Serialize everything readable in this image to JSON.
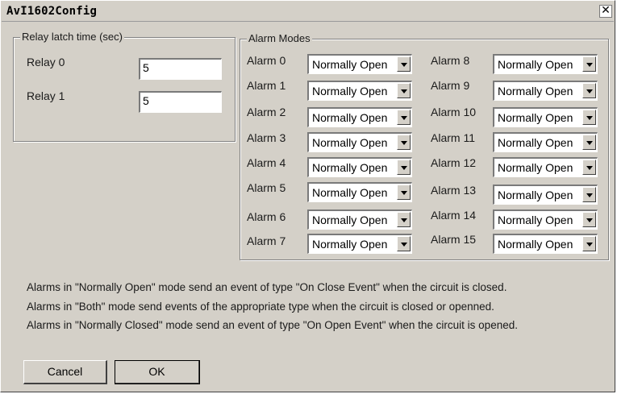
{
  "window": {
    "title": "AvI1602Config",
    "close_glyph": "✕"
  },
  "relay_group": {
    "legend": "Relay latch time (sec)",
    "relays": [
      {
        "label": "Relay 0",
        "value": "5"
      },
      {
        "label": "Relay 1",
        "value": "5"
      }
    ]
  },
  "alarm_group": {
    "legend": "Alarm Modes",
    "alarms": [
      {
        "label": "Alarm 0",
        "mode": "Normally Open"
      },
      {
        "label": "Alarm 1",
        "mode": "Normally Open"
      },
      {
        "label": "Alarm 2",
        "mode": "Normally Open"
      },
      {
        "label": "Alarm 3",
        "mode": "Normally Open"
      },
      {
        "label": "Alarm 4",
        "mode": "Normally Open"
      },
      {
        "label": "Alarm 5",
        "mode": "Normally Open"
      },
      {
        "label": "Alarm 6",
        "mode": "Normally Open"
      },
      {
        "label": "Alarm 7",
        "mode": "Normally Open"
      },
      {
        "label": "Alarm 8",
        "mode": "Normally Open"
      },
      {
        "label": "Alarm 9",
        "mode": "Normally Open"
      },
      {
        "label": "Alarm 10",
        "mode": "Normally Open"
      },
      {
        "label": "Alarm 11",
        "mode": "Normally Open"
      },
      {
        "label": "Alarm 12",
        "mode": "Normally Open"
      },
      {
        "label": "Alarm 13",
        "mode": "Normally Open"
      },
      {
        "label": "Alarm 14",
        "mode": "Normally Open"
      },
      {
        "label": "Alarm 15",
        "mode": "Normally Open"
      }
    ]
  },
  "info_lines": [
    "Alarms in \"Normally Open\" mode send an event of type \"On Close Event\" when the circuit is closed.",
    "Alarms in \"Both\" mode send events of the appropriate type when the circuit is closed or openned.",
    "Alarms in \"Normally Closed\" mode send an event of type \"On Open Event\" when the circuit is opened."
  ],
  "buttons": {
    "cancel": "Cancel",
    "ok": "OK"
  }
}
